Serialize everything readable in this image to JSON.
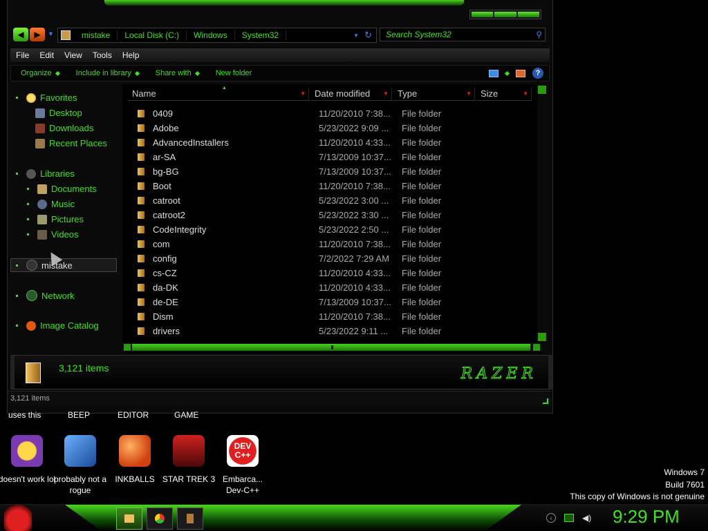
{
  "window": {
    "address": {
      "crumbs": [
        "mistake",
        "Local Disk (C:)",
        "Windows",
        "System32"
      ]
    },
    "search": {
      "placeholder": "Search System32"
    },
    "menu": [
      "File",
      "Edit",
      "View",
      "Tools",
      "Help"
    ],
    "commands": [
      "Organize",
      "Include in library",
      "Share with",
      "New folder"
    ],
    "nav": {
      "favorites": "Favorites",
      "favorites_items": [
        "Desktop",
        "Downloads",
        "Recent Places"
      ],
      "libraries": "Libraries",
      "libraries_items": [
        "Documents",
        "Music",
        "Pictures",
        "Videos"
      ],
      "computer": "mistake",
      "network": "Network",
      "image_catalog": "Image Catalog"
    },
    "columns": [
      "Name",
      "Date modified",
      "Type",
      "Size"
    ],
    "rows": [
      {
        "name": "0409",
        "date": "11/20/2010 7:38...",
        "type": "File folder"
      },
      {
        "name": "Adobe",
        "date": "5/23/2022 9:09 ...",
        "type": "File folder"
      },
      {
        "name": "AdvancedInstallers",
        "date": "11/20/2010 4:33...",
        "type": "File folder"
      },
      {
        "name": "ar-SA",
        "date": "7/13/2009 10:37...",
        "type": "File folder"
      },
      {
        "name": "bg-BG",
        "date": "7/13/2009 10:37...",
        "type": "File folder"
      },
      {
        "name": "Boot",
        "date": "11/20/2010 7:38...",
        "type": "File folder"
      },
      {
        "name": "catroot",
        "date": "5/23/2022 3:00 ...",
        "type": "File folder"
      },
      {
        "name": "catroot2",
        "date": "5/23/2022 3:30 ...",
        "type": "File folder"
      },
      {
        "name": "CodeIntegrity",
        "date": "5/23/2022 2:50 ...",
        "type": "File folder"
      },
      {
        "name": "com",
        "date": "11/20/2010 7:38...",
        "type": "File folder"
      },
      {
        "name": "config",
        "date": "7/2/2022 7:29 AM",
        "type": "File folder"
      },
      {
        "name": "cs-CZ",
        "date": "11/20/2010 4:33...",
        "type": "File folder"
      },
      {
        "name": "da-DK",
        "date": "11/20/2010 4:33...",
        "type": "File folder"
      },
      {
        "name": "de-DE",
        "date": "7/13/2009 10:37...",
        "type": "File folder"
      },
      {
        "name": "Dism",
        "date": "11/20/2010 7:38...",
        "type": "File folder"
      },
      {
        "name": "drivers",
        "date": "5/23/2022 9:11 ...",
        "type": "File folder"
      }
    ],
    "details": {
      "count": "3,121 items",
      "brand": "RAZER"
    },
    "status": {
      "text": "3,121 items"
    }
  },
  "desktop": {
    "top_labels": [
      "uses this",
      "BEEP",
      "EDITOR",
      "GAME"
    ],
    "icons": [
      {
        "label": "doesn't work lol",
        "icon": "yahoo-messenger-icon"
      },
      {
        "label": "probably not a rogue",
        "icon": "gear-setup-icon"
      },
      {
        "label": "INKBALLS",
        "icon": "inkball-icon"
      },
      {
        "label": "STAR TREK 3",
        "icon": "star-trek-icon"
      },
      {
        "label": "Embarca... Dev-C++",
        "icon": "devcpp-icon"
      }
    ],
    "devcpp_badge": "DEV C++",
    "watermark": [
      "Windows 7",
      "Build 7601",
      "This copy of Windows is not genuine"
    ]
  },
  "taskbar": {
    "clock": "9:29 PM"
  },
  "colors": {
    "accent": "#3fe31c",
    "background": "#000000"
  }
}
